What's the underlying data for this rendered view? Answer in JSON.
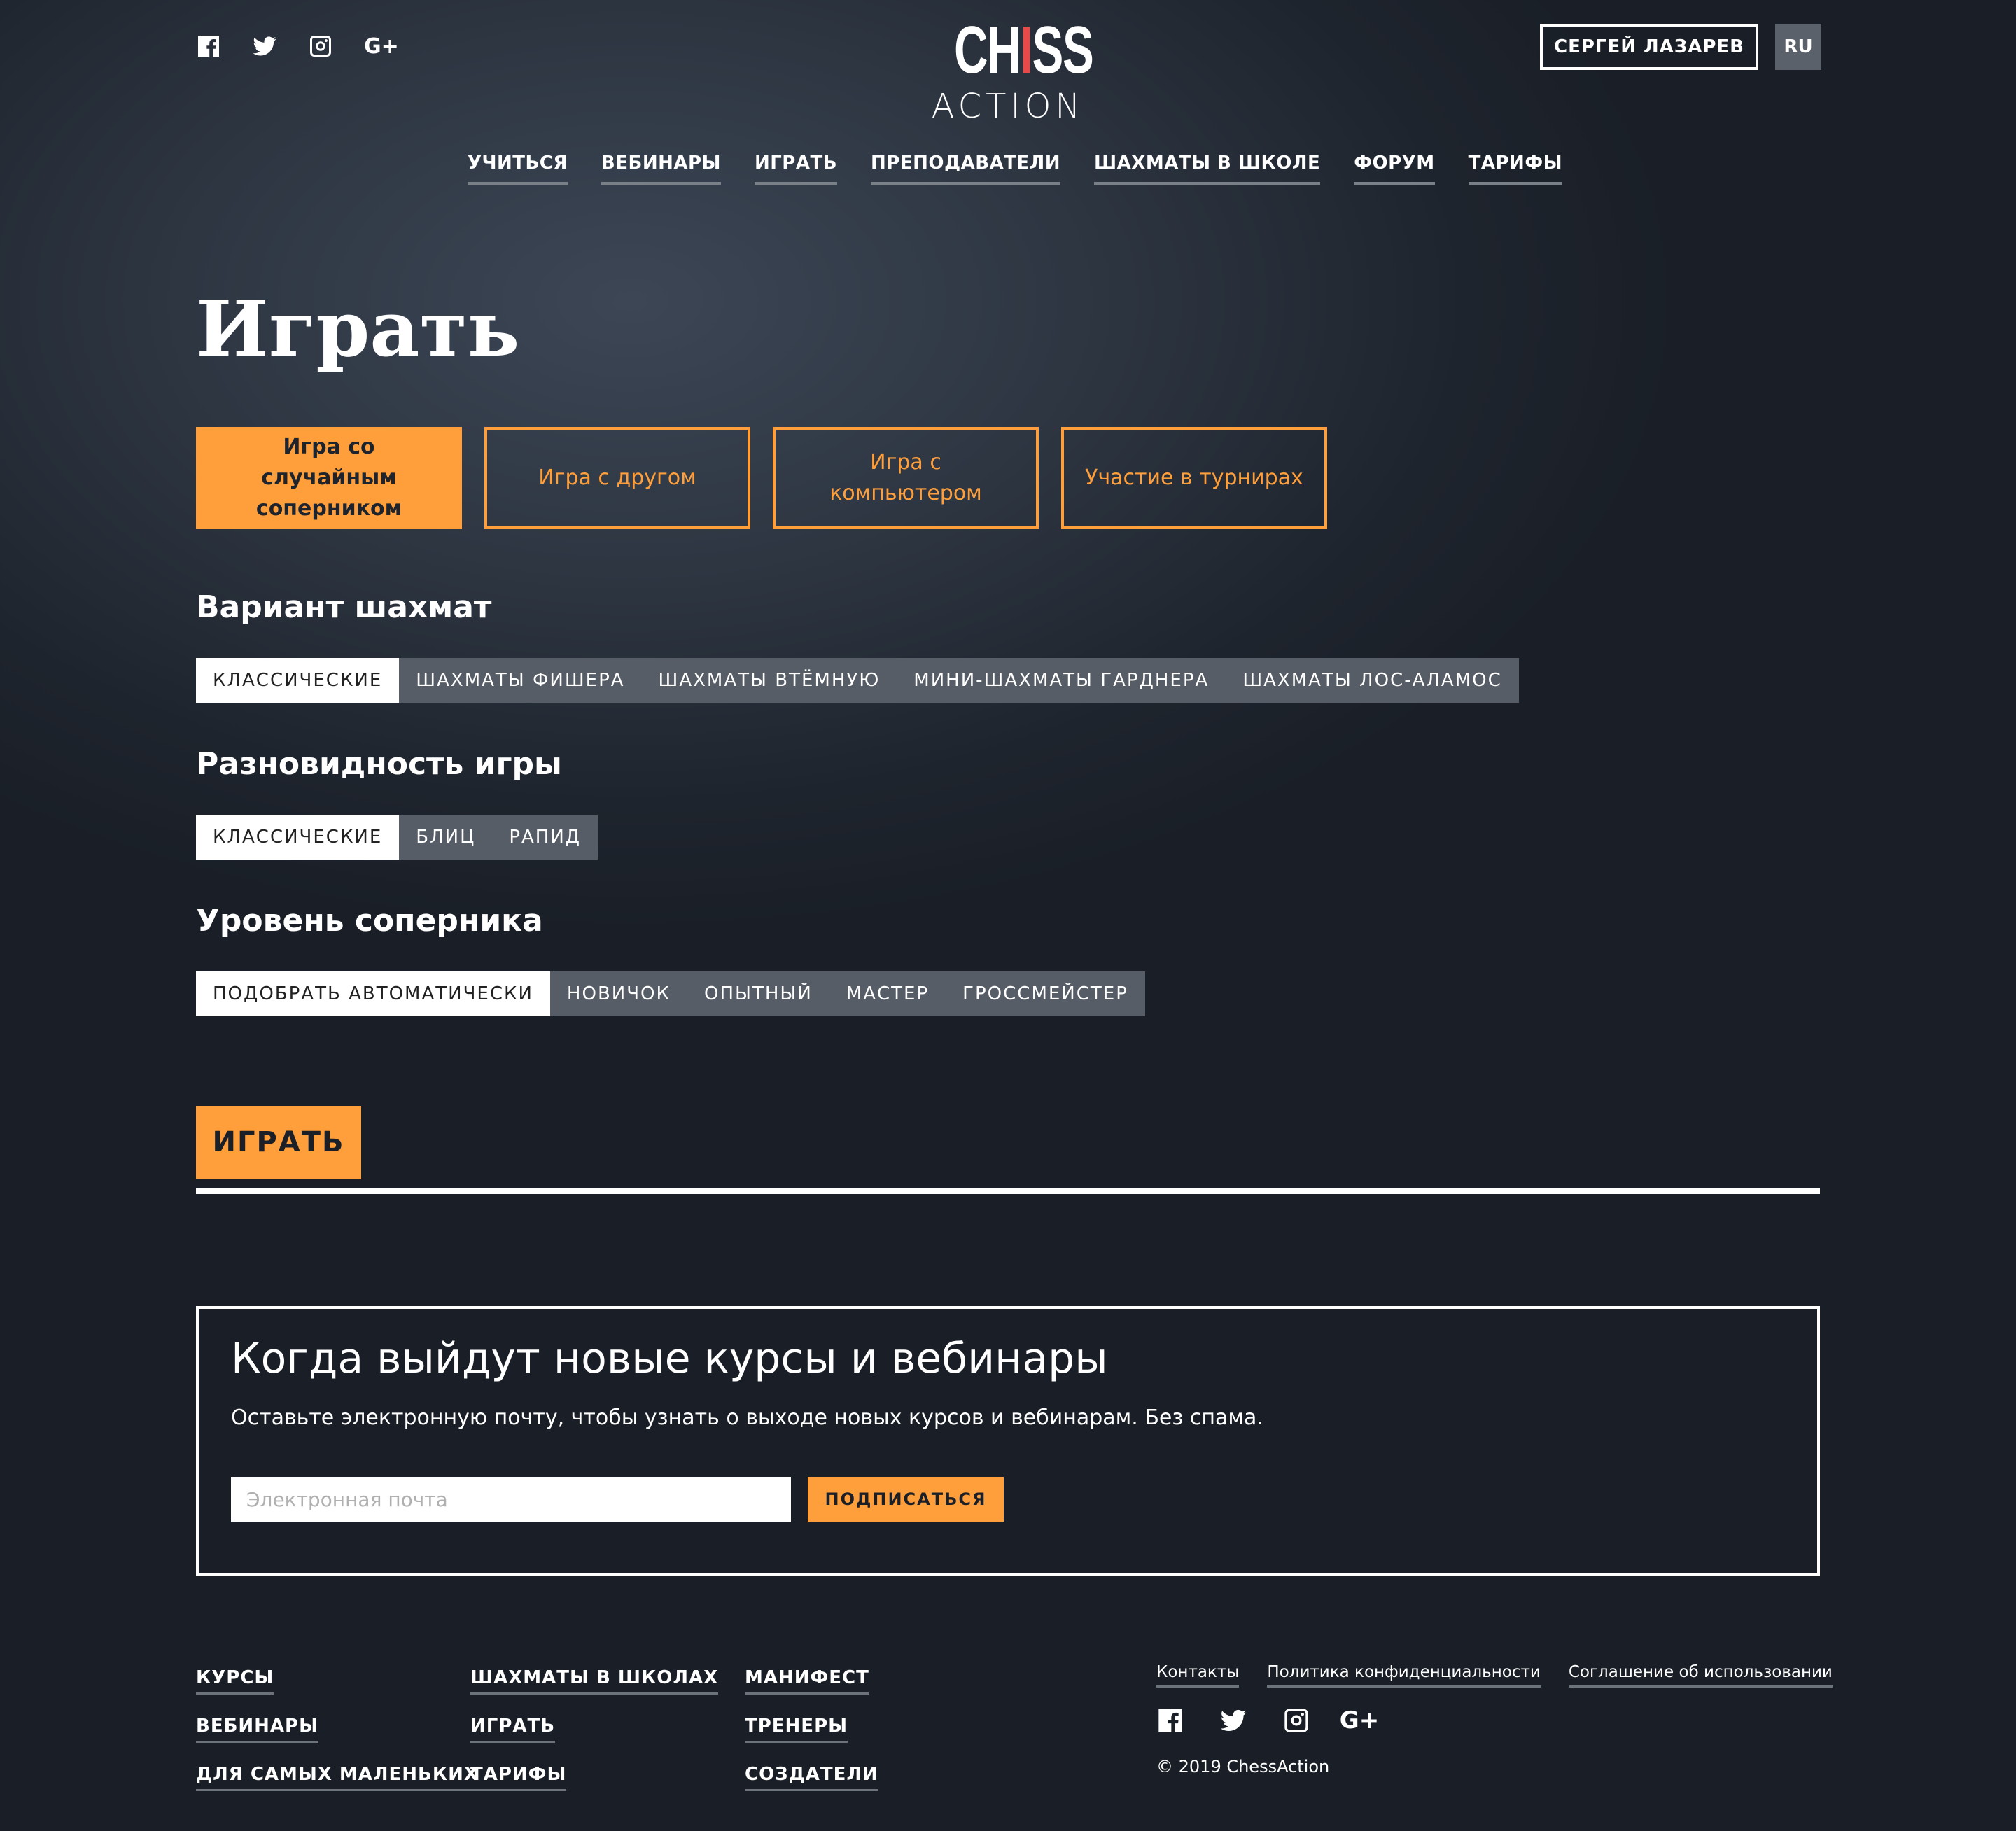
{
  "header": {
    "social": [
      "facebook-icon",
      "twitter-icon",
      "instagram-icon",
      "google-plus-icon"
    ],
    "gplus_label": "G+",
    "logo_top_a": "CH",
    "logo_top_red": "I",
    "logo_top_b": "SS",
    "logo_bottom": "ACTION",
    "user_name": "СЕРГЕЙ ЛАЗАРЕВ",
    "lang": "RU"
  },
  "nav": [
    "УЧИТЬСЯ",
    "ВЕБИНАРЫ",
    "ИГРАТЬ",
    "ПРЕПОДАВАТЕЛИ",
    "ШАХМАТЫ В ШКОЛЕ",
    "ФОРУМ",
    "ТАРИФЫ"
  ],
  "page_title": "Играть",
  "modes": [
    {
      "label": "Игра со случайным соперником",
      "active": true
    },
    {
      "label": "Игра с другом",
      "active": false
    },
    {
      "label": "Игра с компьютером",
      "active": false
    },
    {
      "label": "Участие в турнирах",
      "active": false
    }
  ],
  "variant": {
    "title": "Вариант шахмат",
    "options": [
      "КЛАССИЧЕСКИЕ",
      "ШАХМАТЫ ФИШЕРА",
      "ШАХМАТЫ ВТЁМНУЮ",
      "МИНИ-ШАХМАТЫ ГАРДНЕРА",
      "ШАХМАТЫ ЛОС-АЛАМОС"
    ],
    "selected": 0
  },
  "game_type": {
    "title": "Разновидность игры",
    "options": [
      "КЛАССИЧЕСКИЕ",
      "БЛИЦ",
      "РАПИД"
    ],
    "selected": 0
  },
  "level": {
    "title": "Уровень соперника",
    "options": [
      "ПОДОБРАТЬ АВТОМАТИЧЕСКИ",
      "НОВИЧОК",
      "ОПЫТНЫЙ",
      "МАСТЕР",
      "ГРОССМЕЙСТЕР"
    ],
    "selected": 0
  },
  "play_label": "ИГРАТЬ",
  "subscribe": {
    "title": "Когда выйдут новые курсы и вебинары",
    "text": "Оставьте электронную почту, чтобы узнать о выходе новых курсов и вебинарам. Без спама.",
    "placeholder": "Электронная почта",
    "button": "ПОДПИСАТЬСЯ"
  },
  "footer": {
    "col1": [
      "КУРСЫ",
      "ВЕБИНАРЫ",
      "ДЛЯ САМЫХ МАЛЕНЬКИХ"
    ],
    "col2": [
      "ШАХМАТЫ В ШКОЛАХ",
      "ИГРАТЬ",
      "ТАРИФЫ"
    ],
    "col3": [
      "МАНИФЕСТ",
      "ТРЕНЕРЫ",
      "СОЗДАТЕЛИ"
    ],
    "links": [
      "Контакты",
      "Политика конфиденциальности",
      "Соглашение об использовании"
    ],
    "copyright": "© 2019 ChessAction"
  },
  "colors": {
    "accent": "#ff9f3b",
    "logo_red": "#e84a4a",
    "segment_bg": "#565d67"
  }
}
